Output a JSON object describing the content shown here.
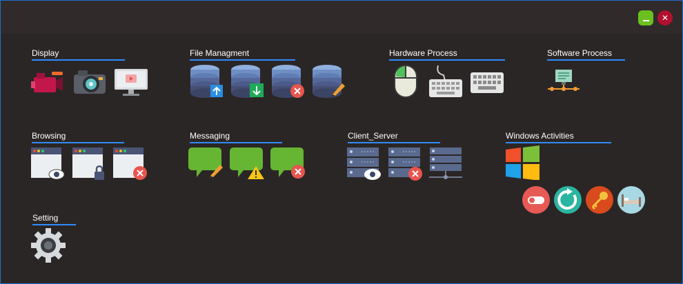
{
  "window": {
    "minimize_symbol": "",
    "close_symbol": "✕",
    "accent": "#2f8cff",
    "background": "#2b2626"
  },
  "sections": {
    "display": {
      "title": "Display",
      "icons": [
        "video-camera-icon",
        "photo-camera-icon",
        "monitor-play-icon"
      ]
    },
    "file_management": {
      "title": "File Managment",
      "icons": [
        "database-upload-icon",
        "database-download-icon",
        "database-delete-icon",
        "database-edit-icon"
      ]
    },
    "hardware_process": {
      "title": "Hardware Process",
      "icons": [
        "mouse-icon",
        "keyboard-wired-icon",
        "keyboard-icon"
      ]
    },
    "software_process": {
      "title": "Software Process",
      "icons": [
        "network-monitor-icon"
      ]
    },
    "browsing": {
      "title": "Browsing",
      "icons": [
        "browser-view-icon",
        "browser-lock-icon",
        "browser-close-icon"
      ]
    },
    "messaging": {
      "title": "Messaging",
      "icons": [
        "message-edit-icon",
        "message-warning-icon",
        "message-delete-icon"
      ]
    },
    "client_server": {
      "title": "Client_Server",
      "icons": [
        "server-view-icon",
        "server-delete-icon",
        "server-network-icon"
      ]
    },
    "windows_activities": {
      "title": "Windows Activities",
      "icons": [
        "windows-logo-icon",
        "toggle-icon",
        "refresh-icon",
        "key-icon",
        "sleep-bed-icon"
      ]
    },
    "setting": {
      "title": "Setting",
      "icons": [
        "gear-icon"
      ]
    }
  }
}
